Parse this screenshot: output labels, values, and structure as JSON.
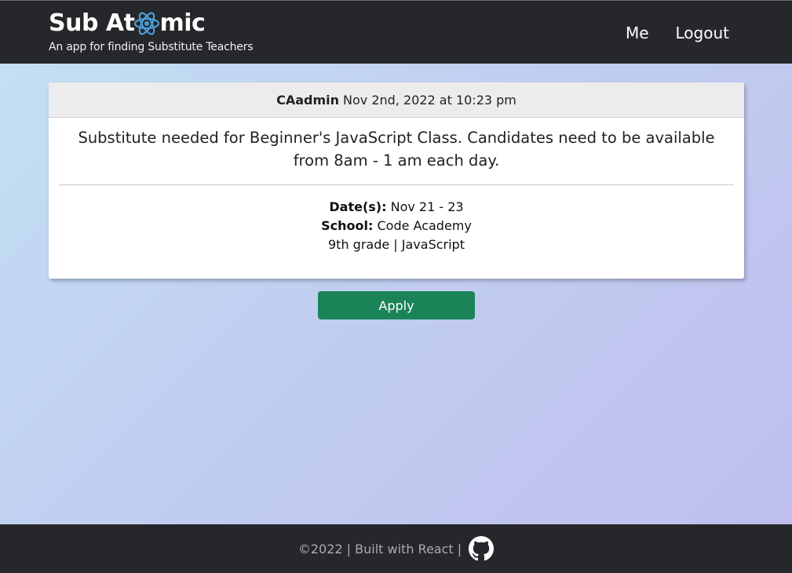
{
  "header": {
    "title_before": "Sub At",
    "title_after": "mic",
    "tagline": "An app for finding Substitute Teachers",
    "nav": [
      {
        "label": "Me"
      },
      {
        "label": "Logout"
      }
    ]
  },
  "post": {
    "author": "CAadmin",
    "timestamp": "Nov 2nd, 2022 at 10:23 pm",
    "description": "Substitute needed for Beginner's JavaScript Class. Candidates need to be available from 8am - 1 am each day.",
    "dates_label": "Date(s):",
    "dates_value": "Nov 21 - 23",
    "school_label": "School:",
    "school_value": "Code Academy",
    "grade_subject": "9th grade | JavaScript"
  },
  "apply_label": "Apply",
  "footer": {
    "text": "©2022 | Built with React |",
    "github_icon": "github-icon"
  },
  "colors": {
    "header_bg": "#25272a",
    "apply_bg": "#1a8458",
    "atom_icon": "#4a9fd8"
  },
  "icons": {
    "logo": "atom-icon"
  }
}
